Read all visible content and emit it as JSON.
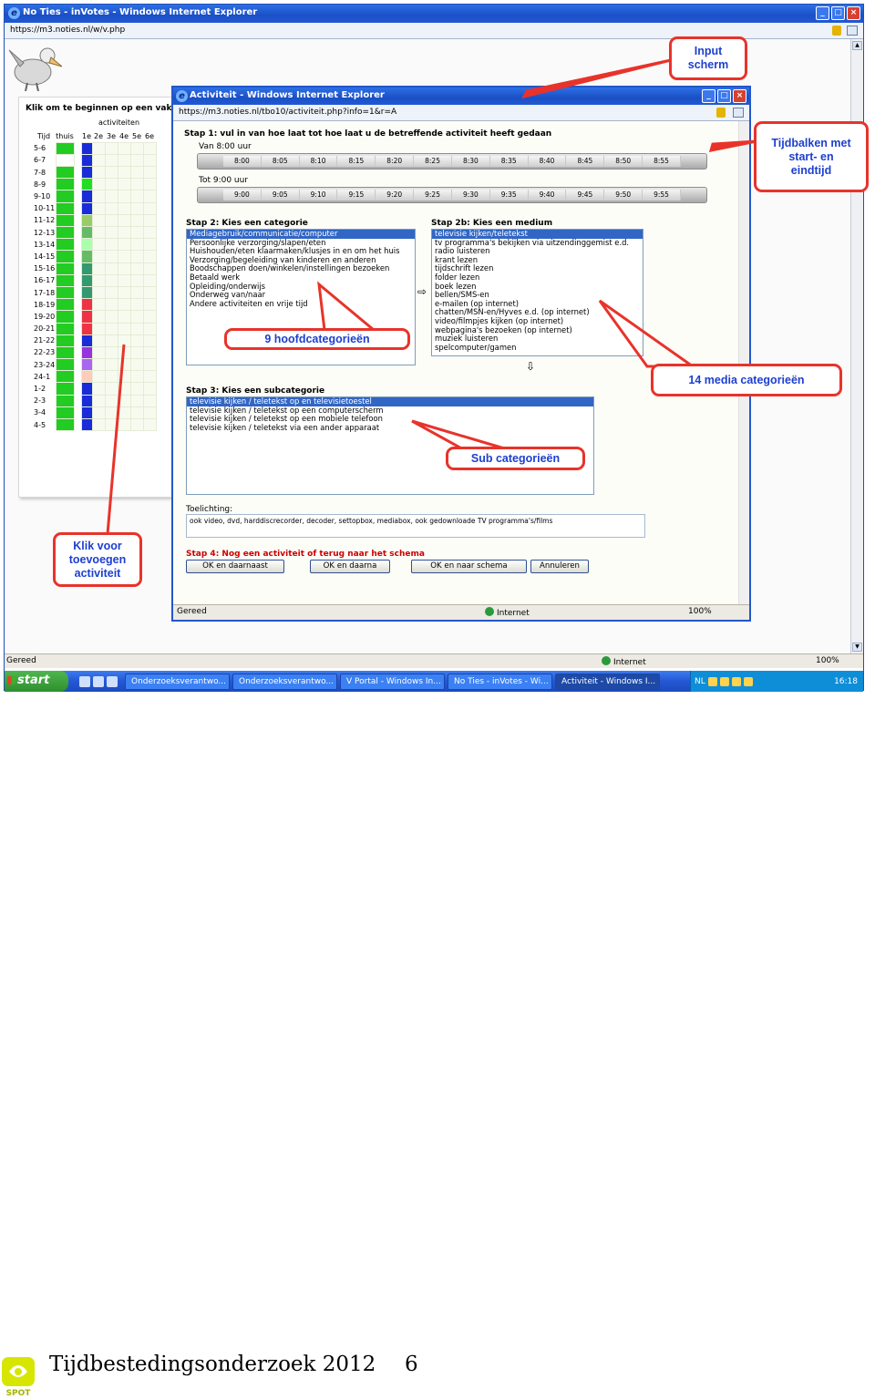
{
  "browser": {
    "title": "No Ties - inVotes - Windows Internet Explorer",
    "address": "https://m3.noties.nl/w/v.php",
    "status_left": "Gereed",
    "status_zone": "Internet",
    "status_zoom": "100%"
  },
  "background_page": {
    "heading": "Klik om te beginnen op een vakje",
    "activities_label": "activiteiten",
    "col_tijd": "Tijd",
    "col_thuis": "thuis",
    "cols": [
      "1e",
      "2e",
      "3e",
      "4e",
      "5e",
      "6e"
    ],
    "rows": [
      {
        "t": "5-6",
        "c1": "#22cc22",
        "c2": "#1a2bd8"
      },
      {
        "t": "6-7",
        "c1": "#ffffff",
        "c2": "#1a2bd8"
      },
      {
        "t": "7-8",
        "c1": "#22cc22",
        "c2": "#1a2bd8"
      },
      {
        "t": "8-9",
        "c1": "#22cc22",
        "c2": "#22dd22"
      },
      {
        "t": "9-10",
        "c1": "#22cc22",
        "c2": "#1a2bd8"
      },
      {
        "t": "10-11",
        "c1": "#22cc22",
        "c2": "#1a2bd8"
      },
      {
        "t": "11-12",
        "c1": "#22cc22",
        "c2": "#99cc66"
      },
      {
        "t": "12-13",
        "c1": "#22cc22",
        "c2": "#66bb66"
      },
      {
        "t": "13-14",
        "c1": "#22cc22",
        "c2": "#aaffaa"
      },
      {
        "t": "14-15",
        "c1": "#22cc22",
        "c2": "#66bb66"
      },
      {
        "t": "15-16",
        "c1": "#22cc22",
        "c2": "#33996f"
      },
      {
        "t": "16-17",
        "c1": "#22cc22",
        "c2": "#33996f"
      },
      {
        "t": "17-18",
        "c1": "#22cc22",
        "c2": "#33996f"
      },
      {
        "t": "18-19",
        "c1": "#22cc22",
        "c2": "#ee3344"
      },
      {
        "t": "19-20",
        "c1": "#22cc22",
        "c2": "#ee3344"
      },
      {
        "t": "20-21",
        "c1": "#22cc22",
        "c2": "#ee3344"
      },
      {
        "t": "21-22",
        "c1": "#22cc22",
        "c2": "#1a2bd8"
      },
      {
        "t": "22-23",
        "c1": "#22cc22",
        "c2": "#9933dd"
      },
      {
        "t": "23-24",
        "c1": "#22cc22",
        "c2": "#aa66ee"
      },
      {
        "t": "24-1",
        "c1": "#22cc22",
        "c2": "#ffccbb"
      },
      {
        "t": "1-2",
        "c1": "#22cc22",
        "c2": "#1a2bd8"
      },
      {
        "t": "2-3",
        "c1": "#22cc22",
        "c2": "#1a2bd8"
      },
      {
        "t": "3-4",
        "c1": "#22cc22",
        "c2": "#1a2bd8"
      },
      {
        "t": "4-5",
        "c1": "#22cc22",
        "c2": "#1a2bd8"
      }
    ]
  },
  "popup": {
    "title": "Activiteit - Windows Internet Explorer",
    "address": "https://m3.noties.nl/tbo10/activiteit.php?info=1&r=A",
    "step1": "Stap 1: vul in van hoe laat tot hoe laat u de betreffende activiteit heeft gedaan",
    "van_label": "Van 8:00 uur",
    "tot_label": "Tot 9:00 uur",
    "van_ticks": [
      "8:00",
      "8:05",
      "8:10",
      "8:15",
      "8:20",
      "8:25",
      "8:30",
      "8:35",
      "8:40",
      "8:45",
      "8:50",
      "8:55"
    ],
    "tot_ticks": [
      "9:00",
      "9:05",
      "9:10",
      "9:15",
      "9:20",
      "9:25",
      "9:30",
      "9:35",
      "9:40",
      "9:45",
      "9:50",
      "9:55"
    ],
    "step2": "Stap 2: Kies een categorie",
    "categories": [
      "Mediagebruik/communicatie/computer",
      "Persoonlijke verzorging/slapen/eten",
      "Huishouden/eten klaarmaken/klusjes in en om het huis",
      "Verzorging/begeleiding van kinderen en anderen",
      "Boodschappen doen/winkelen/instellingen bezoeken",
      "Betaald werk",
      "Opleiding/onderwijs",
      "Onderweg van/naar",
      "Andere activiteiten en vrije tijd"
    ],
    "step2b": "Stap 2b: Kies een medium",
    "media": [
      "televisie kijken/teletekst",
      "tv programma's bekijken via uitzendinggemist e.d.",
      "radio luisteren",
      "krant lezen",
      "tijdschrift lezen",
      "folder lezen",
      "boek lezen",
      "bellen/SMS-en",
      "e-mailen (op internet)",
      "chatten/MSN-en/Hyves e.d. (op internet)",
      "video/filmpjes kijken (op internet)",
      "webpagina's bezoeken (op internet)",
      "muziek luisteren",
      "spelcomputer/gamen"
    ],
    "step3": "Stap 3: Kies een subcategorie",
    "subcategories": [
      "televisie kijken / teletekst op en televisietoestel",
      "televisie kijken / teletekst op een computerscherm",
      "televisie kijken / teletekst op een mobiele telefoon",
      "televisie kijken / teletekst via een ander apparaat"
    ],
    "toelichting_label": "Toelichting:",
    "toelichting_text": "ook video, dvd, harddiscrecorder, decoder, settopbox, mediabox, ook gedownloade TV programma's/films",
    "step4": "Stap 4: Nog een activiteit of terug naar het schema",
    "buttons": [
      "OK en daarnaast",
      "OK en daarna",
      "OK en naar schema",
      "Annuleren"
    ],
    "status_left": "Gereed",
    "status_zone": "Internet",
    "status_zoom": "100%"
  },
  "annotations": {
    "input_scherm": [
      "Input",
      "scherm"
    ],
    "tijdbalken": [
      "Tijdbalken met",
      "start- en",
      "eindtijd"
    ],
    "hoofdcategorieen": "9 hoofdcategorieën",
    "media_categorieen": "14 media categorieën",
    "sub_categorieen": "Sub categorieën",
    "klik_voor": [
      "Klik voor",
      "toevoegen",
      "activiteit"
    ],
    "line_color": "#e8332a",
    "text_color": "#1d3fd0"
  },
  "taskbar": {
    "start": "start",
    "tasks": [
      "Onderzoeksverantwo...",
      "Onderzoeksverantwo...",
      "V Portal - Windows In...",
      "No Ties - inVotes - Wi...",
      "Activiteit - Windows I..."
    ],
    "lang": "NL",
    "clock": "16:18"
  },
  "footer": {
    "title": "Tijdbestedingsonderzoek 2012",
    "page": "6",
    "logo_text": "SPOT"
  }
}
